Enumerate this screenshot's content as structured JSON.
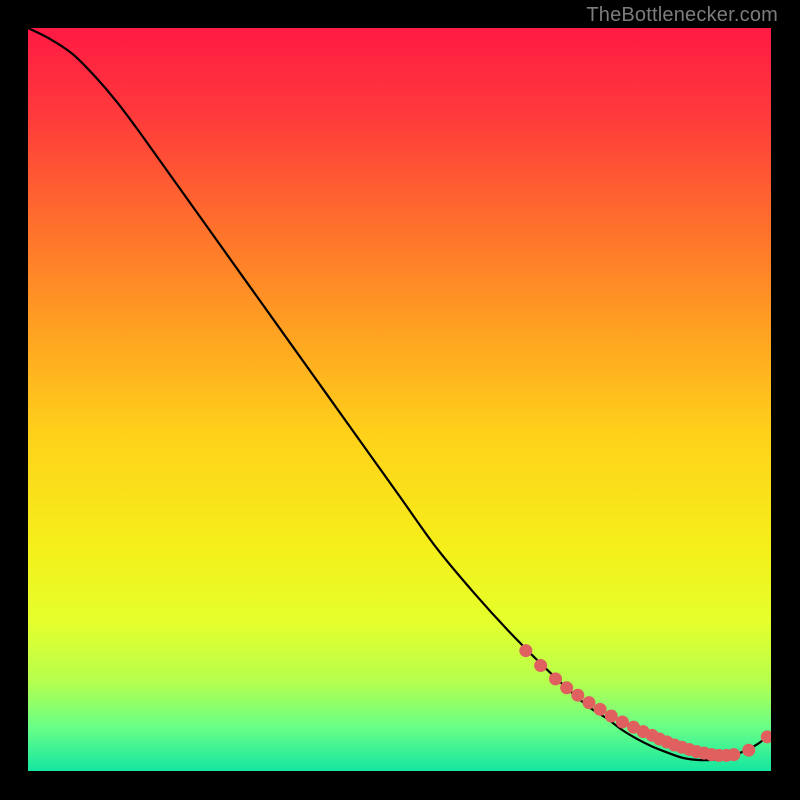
{
  "watermark": "TheBottlenecker.com",
  "chart_data": {
    "type": "line",
    "title": "",
    "xlabel": "",
    "ylabel": "",
    "xlim": [
      0,
      100
    ],
    "ylim": [
      0,
      100
    ],
    "background_gradient": {
      "stops": [
        {
          "offset": 0.0,
          "color": "#ff1a44"
        },
        {
          "offset": 0.12,
          "color": "#ff3b3b"
        },
        {
          "offset": 0.25,
          "color": "#ff6a2e"
        },
        {
          "offset": 0.4,
          "color": "#ff9f22"
        },
        {
          "offset": 0.55,
          "color": "#ffd21a"
        },
        {
          "offset": 0.7,
          "color": "#f5ef1a"
        },
        {
          "offset": 0.8,
          "color": "#e5ff2c"
        },
        {
          "offset": 0.88,
          "color": "#b5ff4e"
        },
        {
          "offset": 0.94,
          "color": "#6aff86"
        },
        {
          "offset": 1.0,
          "color": "#14e6a0"
        }
      ]
    },
    "series": [
      {
        "name": "curve",
        "color": "#000000",
        "x": [
          0,
          3,
          6,
          9,
          12,
          15,
          20,
          25,
          30,
          35,
          40,
          45,
          50,
          55,
          60,
          65,
          70,
          75,
          78,
          80,
          82,
          84,
          86,
          88,
          90,
          92,
          94,
          96,
          98,
          100
        ],
        "y": [
          100,
          98.5,
          96.5,
          93.5,
          90,
          86,
          79,
          72,
          65,
          58,
          51,
          44,
          37,
          30,
          24,
          18.5,
          13.5,
          9,
          7,
          5.5,
          4.3,
          3.3,
          2.5,
          1.8,
          1.5,
          1.5,
          1.8,
          2.5,
          3.5,
          5
        ]
      }
    ],
    "scatter": {
      "name": "points",
      "color": "#e06060",
      "radius": 6.5,
      "x": [
        67,
        69,
        71,
        72.5,
        74,
        75.5,
        77,
        78.5,
        80,
        81.5,
        82.8,
        84,
        85,
        86,
        87,
        88,
        89,
        90,
        91,
        92,
        93,
        94,
        95,
        97,
        99.5
      ],
      "y": [
        16.2,
        14.2,
        12.4,
        11.2,
        10.2,
        9.2,
        8.3,
        7.4,
        6.6,
        5.9,
        5.3,
        4.8,
        4.3,
        3.9,
        3.5,
        3.2,
        2.9,
        2.6,
        2.4,
        2.2,
        2.1,
        2.1,
        2.2,
        2.8,
        4.6
      ]
    }
  }
}
